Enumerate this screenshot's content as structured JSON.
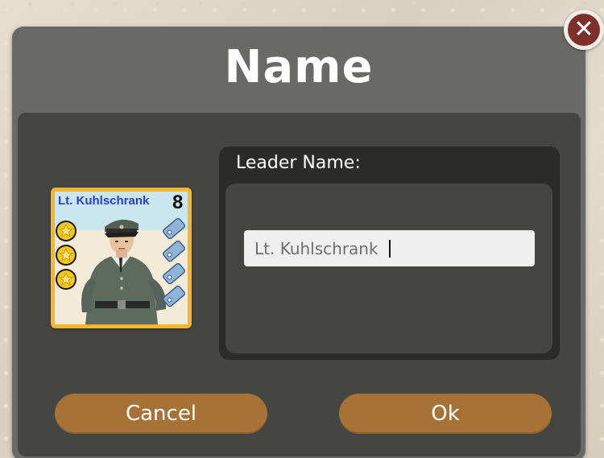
{
  "dialog": {
    "title": "Name",
    "close_icon": "close-x-icon",
    "close_label": "✕"
  },
  "leader_card": {
    "name": "Lt. Kuhlschrank",
    "rating": "8",
    "stars": 3,
    "tags": 4,
    "portrait": "officer-portrait"
  },
  "name_field": {
    "label": "Leader Name:",
    "value": "Lt. Kuhlschrank"
  },
  "buttons": {
    "cancel": "Cancel",
    "ok": "Ok"
  },
  "colors": {
    "dialog_bg": "#696968",
    "panel_bg": "#454544",
    "button_bg": "#a67235",
    "card_border": "#f5b62e",
    "close_red": "#7d2f2c"
  }
}
